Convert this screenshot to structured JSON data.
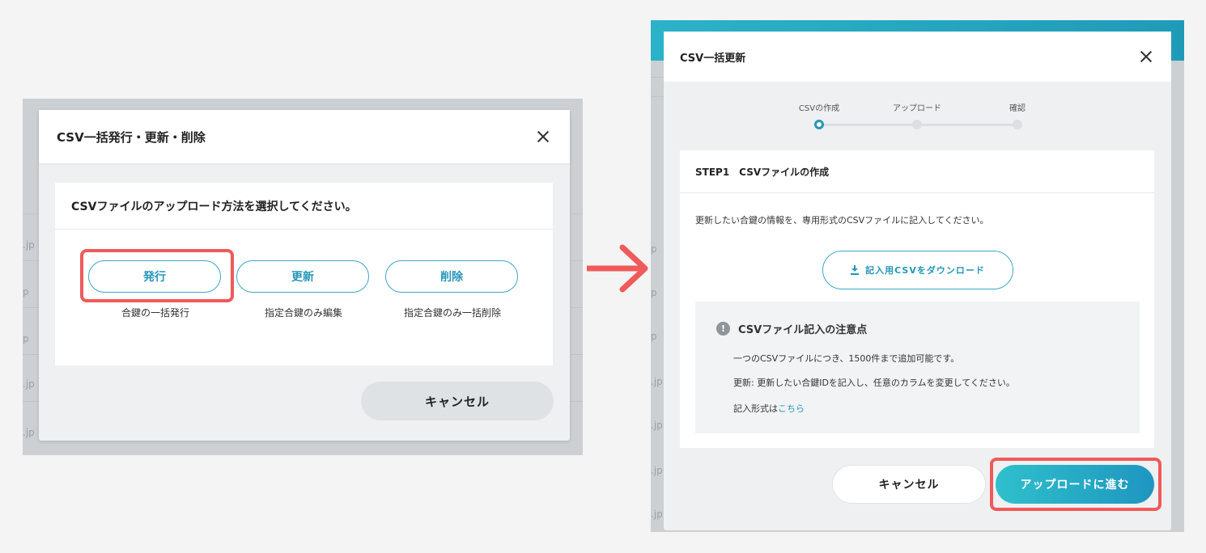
{
  "left": {
    "modal_title": "CSV一括発行・更新・削除",
    "card_heading": "CSVファイルのアップロード方法を選択してください。",
    "options": [
      {
        "label": "発行",
        "desc": "合鍵の一括発行"
      },
      {
        "label": "更新",
        "desc": "指定合鍵のみ編集"
      },
      {
        "label": "削除",
        "desc": "指定合鍵のみ一括削除"
      }
    ],
    "cancel_label": "キャンセル",
    "bg_fragments": [
      ".jp",
      "p",
      "p",
      ".jp",
      ".jp"
    ]
  },
  "right": {
    "modal_title": "CSV一括更新",
    "steps": [
      "CSVの作成",
      "アップロード",
      "確認"
    ],
    "active_step": 1,
    "step_heading": "STEP1　CSVファイルの作成",
    "instruction": "更新したい合鍵の情報を、専用形式のCSVファイルに記入してください。",
    "download_label": "記入用CSVをダウンロード",
    "notice": {
      "title": "CSVファイル記入の注意点",
      "line1": "一つのCSVファイルにつき、1500件まで追加可能です。",
      "line2": "更新: 更新したい合鍵IDを記入し、任意のカラムを変更してください。",
      "line3_prefix": "記入形式は",
      "line3_link": "こちら"
    },
    "cancel_label": "キャンセル",
    "next_label": "アップロードに進む",
    "bg_fragments": [
      "p",
      "p",
      "p",
      ".jp",
      ".jp",
      ".jp",
      ".jp"
    ]
  },
  "colors": {
    "accent": "#2596b8",
    "highlight": "#ef5a5a",
    "arrow": "#ef5a5a"
  }
}
